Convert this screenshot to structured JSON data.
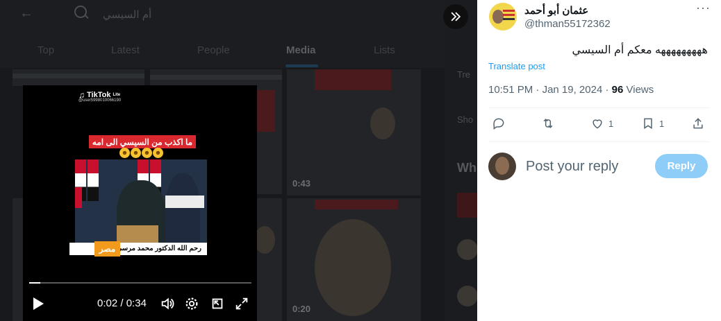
{
  "background": {
    "search_query": "أم السيسي",
    "tabs": [
      "Top",
      "Latest",
      "People",
      "Media",
      "Lists"
    ],
    "active_tab": "Media",
    "tile_durations": [
      "0:43",
      "0:20"
    ]
  },
  "video": {
    "brand": "TikTok",
    "brand_suffix": "Lite",
    "user": "@user5998010066190",
    "caption": "ما اكذب من السيسي الى امه",
    "bottom_text": "رحم الله الدكتور محمد مرسي",
    "badge": "مصر",
    "current_time": "0:02",
    "duration": "0:34",
    "progress_fraction": 0.05
  },
  "tweet": {
    "display_name": "عثمان أبو أحمد",
    "handle": "@thman55172362",
    "text": "هههههههههه معكم أم السيسي",
    "translate_label": "Translate post",
    "time": "10:51 PM",
    "date": "Jan 19, 2024",
    "views_count": "96",
    "views_label": "Views",
    "likes": "1",
    "bookmarks": "1"
  },
  "reply": {
    "placeholder": "Post your reply",
    "button_label": "Reply"
  },
  "colors": {
    "accent": "#1d9bf0",
    "reply_button_disabled": "#8ecdf8",
    "secondary_text": "#536471"
  }
}
